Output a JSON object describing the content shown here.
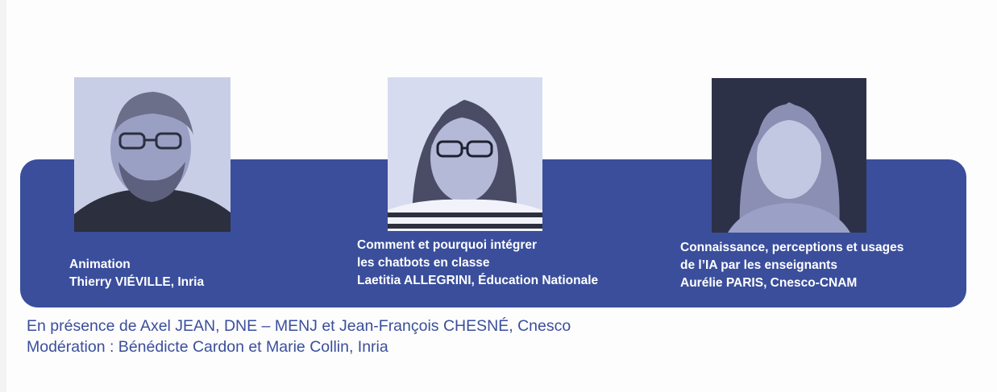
{
  "colors": {
    "band": "#3a4e9b",
    "footer_text": "#3a4e9b",
    "caption_text": "#ffffff",
    "photo_tint": "#c7cde6"
  },
  "speakers": [
    {
      "photo": "portrait-photo",
      "lines": [
        "Animation",
        "Thierry VIÉVILLE, Inria"
      ]
    },
    {
      "photo": "portrait-photo",
      "lines": [
        "Comment et pourquoi intégrer",
        "les chatbots en classe",
        "Laetitia ALLEGRINI, Éducation Nationale"
      ]
    },
    {
      "photo": "portrait-photo",
      "lines": [
        "Connaissance, perceptions et usages",
        "de l’IA par les enseignants",
        "Aurélie PARIS, Cnesco-CNAM"
      ]
    }
  ],
  "footer": {
    "line1": "En présence de Axel JEAN, DNE – MENJ et Jean-François CHESNÉ, Cnesco",
    "line2": "Modération : Bénédicte Cardon et Marie Collin, Inria"
  }
}
